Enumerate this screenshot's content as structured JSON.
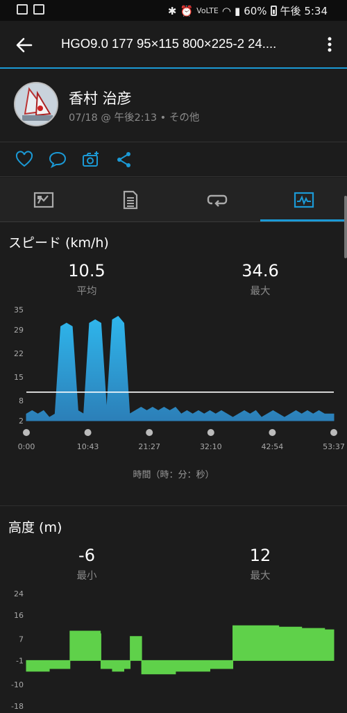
{
  "statusbar": {
    "battery": "60%",
    "time": "午後 5:34",
    "volte": "VoLTE"
  },
  "appbar": {
    "title": "HGO9.0  177  95×115  800×225-2  24...."
  },
  "profile": {
    "name": "香村 治彦",
    "meta": "07/18 @ 午後2:13 • その他"
  },
  "tabs": [
    "overview",
    "details",
    "laps",
    "charts"
  ],
  "speed": {
    "title": "スピード (km/h)",
    "avg_value": "10.5",
    "avg_label": "平均",
    "max_value": "34.6",
    "max_label": "最大",
    "xlabel": "時間（時：分：秒）"
  },
  "altitude": {
    "title": "高度 (m)",
    "min_value": "-6",
    "min_label": "最小",
    "max_value": "12",
    "max_label": "最大"
  },
  "colors": {
    "accent": "#1b9ad6",
    "speed_fill": "#1e9ad8",
    "altitude_fill": "#5fd14a"
  },
  "chart_data": [
    {
      "type": "area",
      "ylim": [
        2,
        35
      ],
      "yticks": [
        35,
        29,
        22,
        15,
        8,
        2
      ],
      "xticks": [
        "0:00",
        "10:43",
        "21:27",
        "32:10",
        "42:54",
        "53:37"
      ],
      "x_minutes": [
        0,
        1,
        2,
        3,
        4,
        5,
        6,
        7,
        8,
        9,
        10,
        11,
        12,
        13,
        14,
        15,
        16,
        17,
        18,
        19,
        20,
        21,
        22,
        23,
        24,
        25,
        26,
        27,
        28,
        29,
        30,
        31,
        32,
        33,
        34,
        35,
        36,
        37,
        38,
        39,
        40,
        41,
        42,
        43,
        44,
        45,
        46,
        47,
        48,
        49,
        50,
        51,
        52,
        53.6
      ],
      "values": [
        4,
        5,
        4,
        5,
        3,
        4,
        30,
        31,
        30,
        5,
        4,
        31,
        32,
        31,
        5,
        32,
        33,
        31,
        4,
        5,
        6,
        5,
        6,
        5,
        6,
        5,
        6,
        4,
        5,
        4,
        5,
        4,
        5,
        4,
        5,
        4,
        3,
        4,
        5,
        4,
        5,
        3,
        4,
        5,
        4,
        3,
        4,
        5,
        4,
        5,
        4,
        5,
        4,
        4
      ],
      "average": 10.5
    },
    {
      "type": "area",
      "ylim": [
        -18,
        24
      ],
      "yticks": [
        24,
        16,
        7,
        -1,
        -10,
        -18
      ],
      "x_minutes": [
        0,
        4,
        7.5,
        7.6,
        10,
        12.9,
        13,
        15,
        17,
        18,
        18.1,
        20,
        20.1,
        23,
        26,
        29,
        32,
        35.9,
        36,
        40,
        44,
        48,
        52,
        53.6
      ],
      "values": [
        -5,
        -4,
        -4,
        10,
        10,
        9,
        -4,
        -5,
        -4,
        -4,
        8,
        8,
        -6,
        -6,
        -5,
        -5,
        -4,
        -4,
        12,
        12,
        11.5,
        11,
        10.5,
        10
      ]
    }
  ]
}
